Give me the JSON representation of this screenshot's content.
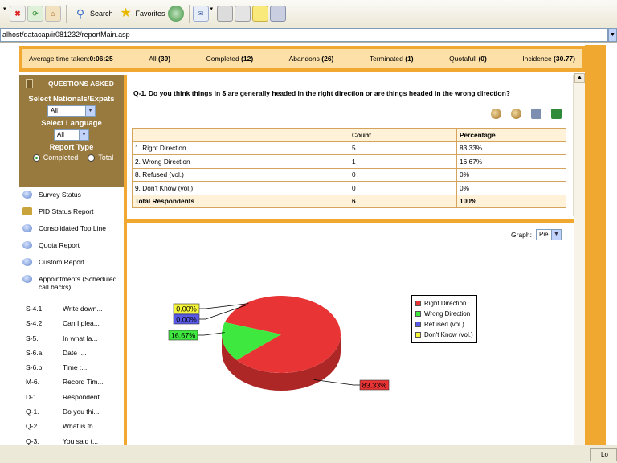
{
  "toolbar": {
    "search_label": "Search",
    "favorites_label": "Favorites"
  },
  "address": {
    "url": "alhost/datacap/ir081232/reportMain.asp"
  },
  "stats": {
    "avg_label": "Average time taken:",
    "avg_value": "0:06:25",
    "all_label": "All",
    "all_value": "(39)",
    "completed_label": "Completed",
    "completed_value": "(12)",
    "abandons_label": "Abandons",
    "abandons_value": "(26)",
    "terminated_label": "Terminated",
    "terminated_value": "(1)",
    "quotafull_label": "Quotafull",
    "quotafull_value": "(0)",
    "incidence_label": "Incidence",
    "incidence_value": "(30.77)"
  },
  "sidebar": {
    "questions_asked": "QUESTIONS ASKED",
    "nationals_label": "Select Nationals/Expats",
    "nationals_value": "All",
    "language_label": "Select Language",
    "language_value": "All",
    "report_type_label": "Report Type",
    "completed_label": "Completed",
    "total_label": "Total",
    "menu": [
      "Survey Status",
      "PID Status Report",
      "Consolidated Top Line",
      "Quota Report",
      "Custom Report",
      "Appointments (Scheduled call backs)"
    ],
    "questions": [
      {
        "code": "S-4.1.",
        "text": "Write down..."
      },
      {
        "code": "S-4.2.",
        "text": "Can I plea..."
      },
      {
        "code": "S-5.",
        "text": "In what la..."
      },
      {
        "code": "S-6.a.",
        "text": "Date :..."
      },
      {
        "code": "S-6.b.",
        "text": "Time :..."
      },
      {
        "code": "M-6.",
        "text": "Record Tim..."
      },
      {
        "code": "D-1.",
        "text": "Respondent..."
      },
      {
        "code": "Q-1.",
        "text": "Do you thi..."
      },
      {
        "code": "Q-2.",
        "text": "What is th..."
      },
      {
        "code": "Q-3.",
        "text": "You said t..."
      }
    ]
  },
  "question": {
    "title": "Q-1. Do you think things in $ are generally headed in the right direction or are things headed in the wrong direction?"
  },
  "table": {
    "headers": [
      "",
      "Count",
      "Percentage"
    ],
    "rows": [
      [
        "1. Right Direction",
        "5",
        "83.33%"
      ],
      [
        "2. Wrong Direction",
        "1",
        "16.67%"
      ],
      [
        "8. Refused (vol.)",
        "0",
        "0%"
      ],
      [
        "9. Don't Know (vol.)",
        "0",
        "0%"
      ]
    ],
    "total": [
      "Total Respondents",
      "6",
      "100%"
    ]
  },
  "graph": {
    "label": "Graph:",
    "value": "Pie"
  },
  "chart_data": {
    "type": "pie",
    "categories": [
      "Right Direction",
      "Wrong Direction",
      "Refused (vol.)",
      "Don't Know (vol.)"
    ],
    "values": [
      83.33,
      16.67,
      0,
      0
    ],
    "data_labels": [
      "83.33%",
      "16.67%",
      "0.00%",
      "0.00%"
    ],
    "colors": [
      "#e83434",
      "#3ee83e",
      "#5a5ae8",
      "#f5f53a"
    ],
    "legend_position": "right"
  },
  "status": {
    "text": "Lo"
  }
}
